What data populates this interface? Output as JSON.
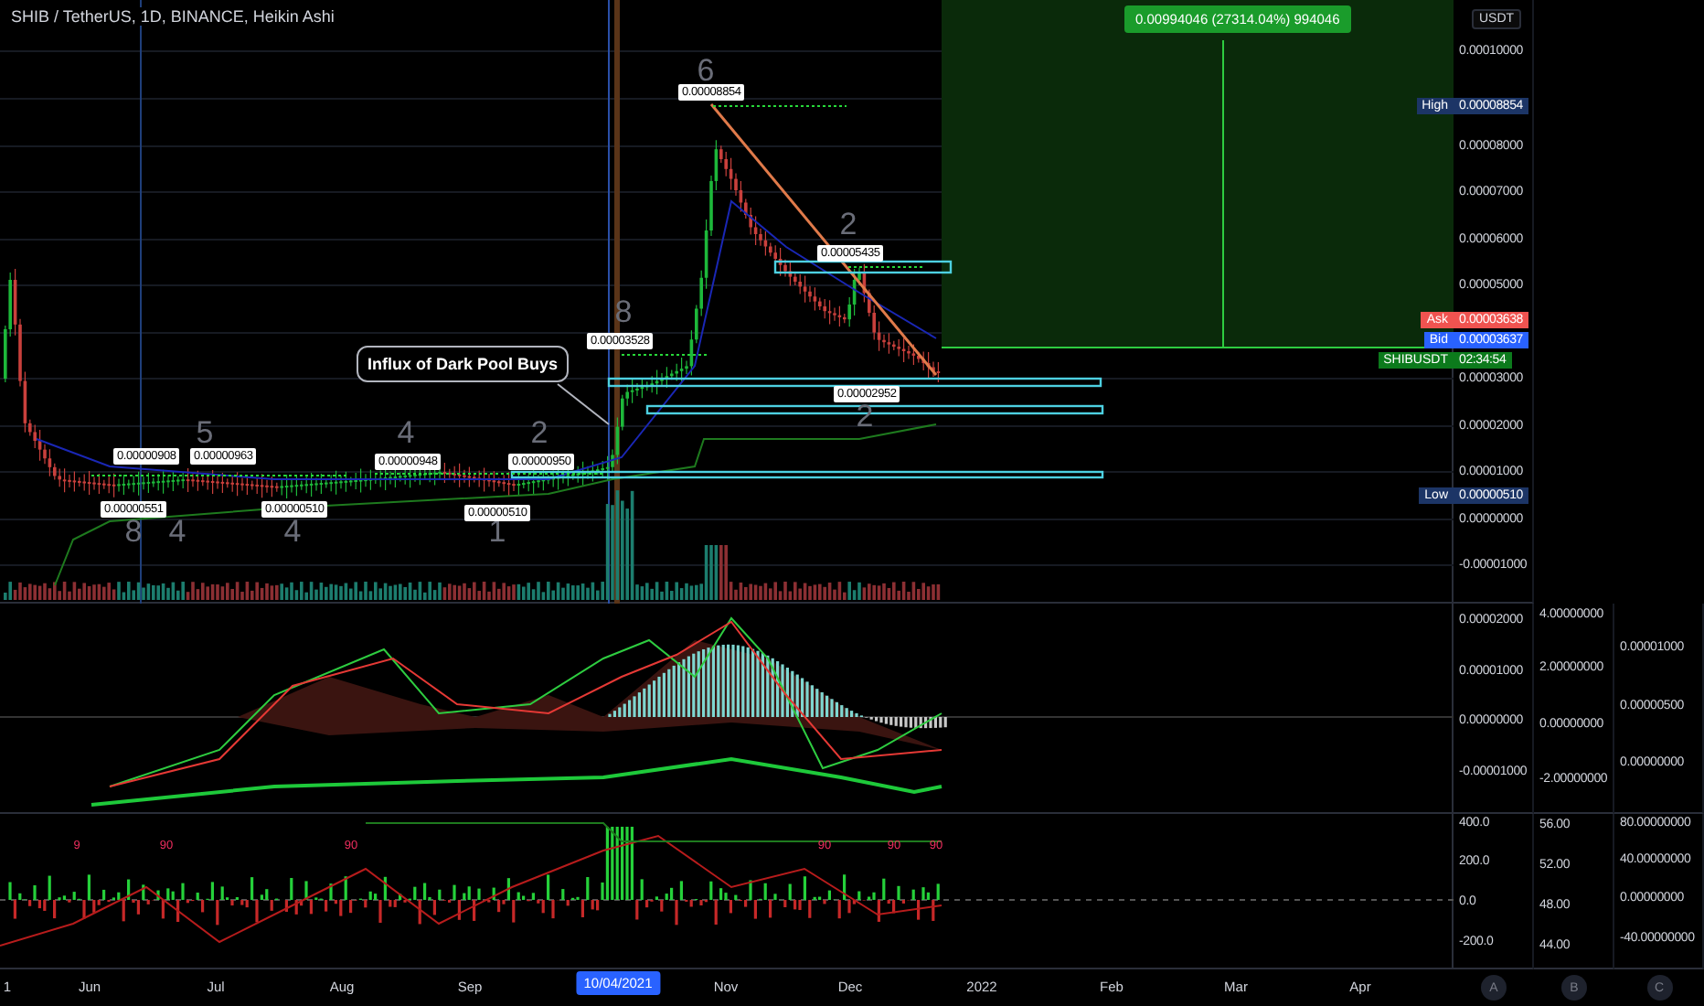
{
  "header": {
    "title": "SHIB / TetherUS, 1D, BINANCE, Heikin Ashi"
  },
  "measure": {
    "label": "0.00994046 (27314.04%) 994046"
  },
  "callout": {
    "text": "Influx of Dark Pool Buys"
  },
  "price_tags": [
    "0.00000908",
    "0.00000963",
    "0.00000551",
    "0.00000510",
    "0.00000948",
    "0.00000950",
    "0.00000510",
    "0.00003528",
    "0.00008854",
    "0.00005435",
    "0.00002952"
  ],
  "wave_labels": [
    "6",
    "2",
    "8",
    "5",
    "4",
    "2",
    "8",
    "4",
    "4",
    "1",
    "2"
  ],
  "signal_labels": [
    "9",
    "90",
    "90",
    "90",
    "90",
    "90"
  ],
  "price_axis": {
    "unit": "USDT",
    "ticks": [
      "0.00010000",
      "0.00008000",
      "0.00007000",
      "0.00006000",
      "0.00005000",
      "0.00003000",
      "0.00002000",
      "0.00001000",
      "0.00000000",
      "-0.00001000"
    ]
  },
  "badges": [
    {
      "kind": "high",
      "label": "High",
      "value": "0.00008854"
    },
    {
      "kind": "ask",
      "label": "Ask",
      "value": "0.00003638"
    },
    {
      "kind": "bid",
      "label": "Bid",
      "value": "0.00003637"
    },
    {
      "kind": "symbol",
      "label": "SHIBUSDT",
      "value": "02:34:54"
    },
    {
      "kind": "low",
      "label": "Low",
      "value": "0.00000510"
    }
  ],
  "macd_axes": {
    "a": [
      "0.00002000",
      "0.00001000",
      "0.00000000",
      "-0.00001000"
    ],
    "b": [
      "4.00000000",
      "2.00000000",
      "0.00000000",
      "-2.00000000"
    ],
    "c": [
      "0.00001000",
      "0.00000500",
      "0.00000000"
    ]
  },
  "osc_axes": {
    "a": [
      "400.0",
      "200.0",
      "0.0",
      "-200.0"
    ],
    "b": [
      "56.00",
      "52.00",
      "48.00",
      "44.00"
    ],
    "c": [
      "80.00000000",
      "40.00000000",
      "0.00000000",
      "-40.00000000"
    ]
  },
  "time_axis": {
    "labels": [
      {
        "text": "1",
        "selected": false
      },
      {
        "text": "Jun",
        "selected": false
      },
      {
        "text": "Jul",
        "selected": false
      },
      {
        "text": "Aug",
        "selected": false
      },
      {
        "text": "Sep",
        "selected": false
      },
      {
        "text": "10/04/2021",
        "selected": true
      },
      {
        "text": "Nov",
        "selected": false
      },
      {
        "text": "Dec",
        "selected": false
      },
      {
        "text": "2022",
        "selected": false
      },
      {
        "text": "Feb",
        "selected": false
      },
      {
        "text": "Mar",
        "selected": false
      },
      {
        "text": "Apr",
        "selected": false
      }
    ]
  },
  "scale_buttons": [
    "A",
    "B",
    "C"
  ]
}
